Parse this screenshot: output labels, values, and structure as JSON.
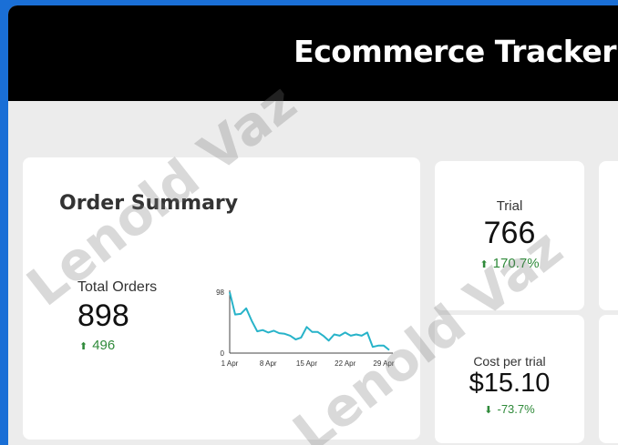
{
  "header": {
    "title": "Ecommerce Tracker"
  },
  "order_summary": {
    "title": "Order Summary",
    "total_label": "Total Orders",
    "total_value": "898",
    "delta": "496",
    "delta_direction": "up",
    "chart_data": {
      "type": "line",
      "ylim": [
        0,
        98
      ],
      "y_ticks": [
        "98",
        "0"
      ],
      "x_ticks": [
        "1 Apr",
        "8 Apr",
        "15 Apr",
        "22 Apr",
        "29 Apr"
      ],
      "x": [
        1,
        2,
        3,
        4,
        5,
        6,
        7,
        8,
        9,
        10,
        11,
        12,
        13,
        14,
        15,
        16,
        17,
        18,
        19,
        20,
        21,
        22,
        23,
        24,
        25,
        26,
        27,
        28,
        29,
        30
      ],
      "values": [
        98,
        62,
        63,
        72,
        52,
        35,
        37,
        33,
        36,
        32,
        31,
        28,
        22,
        25,
        42,
        34,
        34,
        28,
        20,
        30,
        28,
        33,
        28,
        30,
        28,
        33,
        10,
        12,
        12,
        5
      ],
      "color": "#27b3c9"
    }
  },
  "trial": {
    "label": "Trial",
    "value": "766",
    "delta": "170.7%",
    "delta_direction": "up"
  },
  "cost_per_trial": {
    "label": "Cost per trial",
    "value": "$15.10",
    "delta": "-73.7%",
    "delta_direction": "down"
  },
  "watermark": "Lenold Vaz",
  "colors": {
    "accent_blue": "#1a6fd6",
    "positive": "#2f8a3a",
    "line": "#27b3c9"
  },
  "icons": {
    "up": "arrow-up-icon",
    "down": "arrow-down-icon"
  }
}
